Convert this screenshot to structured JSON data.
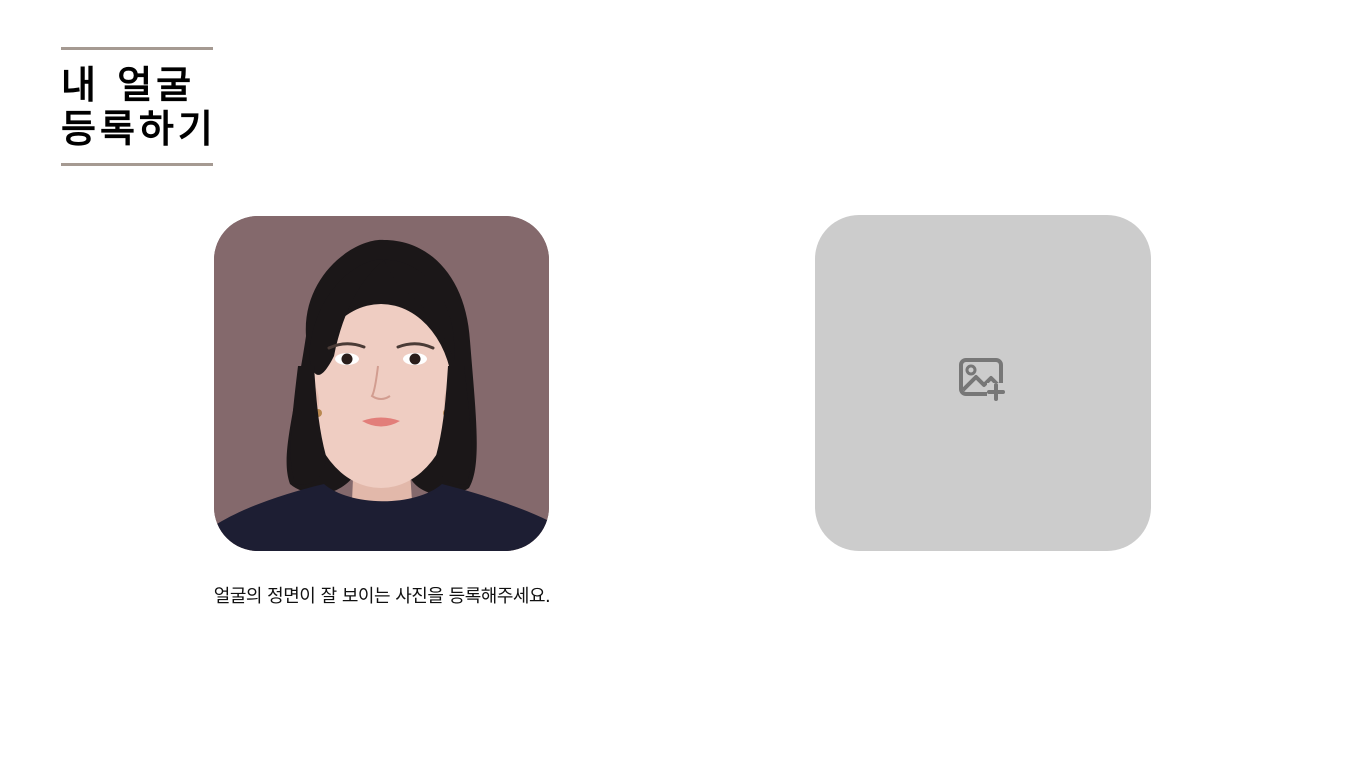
{
  "header": {
    "title_line1": "내 얼굴",
    "title_line2": "등록하기"
  },
  "registered_photo": {
    "alt": "registered face photo"
  },
  "caption": "얼굴의 정면이 잘 보이는 사진을 등록해주세요.",
  "upload_slot": {
    "icon": "add-image-icon"
  },
  "colors": {
    "divider": "#a59a92",
    "upload_bg": "#cccccc",
    "icon": "#777777",
    "photo_bg": "#84696c"
  }
}
